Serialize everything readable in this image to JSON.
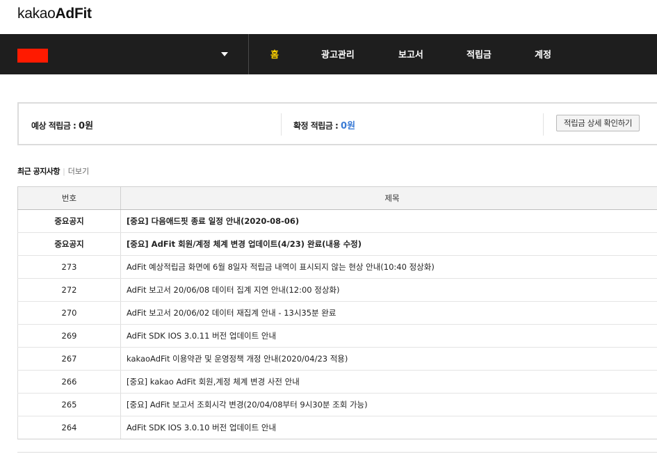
{
  "logo": {
    "prefix": "kakao",
    "brand": "AdFit"
  },
  "account": {
    "color": "#ff1a00"
  },
  "nav": [
    {
      "label": "홈",
      "active": true
    },
    {
      "label": "광고관리",
      "active": false
    },
    {
      "label": "보고서",
      "active": false
    },
    {
      "label": "적립금",
      "active": false
    },
    {
      "label": "계정",
      "active": false
    }
  ],
  "summary": {
    "expected_label": "예상 적립금 : ",
    "expected_value": "0원",
    "confirmed_label": "확정 적립금 : ",
    "confirmed_value": "0원",
    "detail_button": "적립금 상세 확인하기"
  },
  "notices": {
    "title": "최근 공지사항",
    "more": "더보기",
    "columns": {
      "no": "번호",
      "title": "제목"
    },
    "rows": [
      {
        "no": "중요공지",
        "title": "[중요] 다음애드핏 종료 일정 안내(2020-08-06)",
        "important": true
      },
      {
        "no": "중요공지",
        "title": "[중요] AdFit 회원/계정 체계 변경 업데이트(4/23) 완료(내용 수정)",
        "important": true
      },
      {
        "no": "273",
        "title": "AdFit 예상적립금 화면에 6월 8일자 적립금 내역이 표시되지 않는 현상 안내(10:40 정상화)",
        "important": false
      },
      {
        "no": "272",
        "title": "AdFit 보고서 20/06/08 데이터 집계 지연 안내(12:00 정상화)",
        "important": false
      },
      {
        "no": "270",
        "title": "AdFit 보고서 20/06/02 데이터 재집계 안내 - 13시35분 완료",
        "important": false
      },
      {
        "no": "269",
        "title": "AdFit SDK IOS 3.0.11 버전 업데이트 안내",
        "important": false
      },
      {
        "no": "267",
        "title": "kakaoAdFit 이용약관 및 운영정책 개정 안내(2020/04/23 적용)",
        "important": false
      },
      {
        "no": "266",
        "title": "[중요] kakao AdFit 회원,계정 체계 변경 사전 안내",
        "important": false
      },
      {
        "no": "265",
        "title": "[중요] AdFit 보고서 조회시각 변경(20/04/08부터 9시30분 조회 가능)",
        "important": false
      },
      {
        "no": "264",
        "title": "AdFit SDK IOS 3.0.10 버전 업데이트 안내",
        "important": false
      }
    ]
  },
  "colors": {
    "nav_bg": "#1e1e1e",
    "nav_active": "#ffd200",
    "value_blue": "#3a7bd5"
  }
}
